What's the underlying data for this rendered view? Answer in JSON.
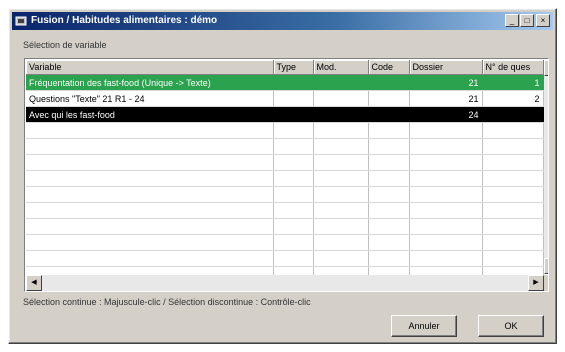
{
  "window": {
    "title": "Fusion / Habitudes alimentaires : démo",
    "minimize": "_",
    "maximize": "□",
    "close": "×"
  },
  "selection_label": "Sélection de variable",
  "table": {
    "columns": [
      "Variable",
      "Type",
      "Mod.",
      "Code",
      "Dossier",
      "N° de ques"
    ],
    "rows": [
      {
        "variable": "Fréquentation des fast-food (Unique -> Texte)",
        "type": "",
        "mod": "",
        "code": "",
        "dossier": "21",
        "num": "1",
        "state": "selected-green"
      },
      {
        "variable": "Questions \"Texte\" 21 R1 - 24",
        "type": "",
        "mod": "",
        "code": "",
        "dossier": "21",
        "num": "2",
        "state": "normal"
      },
      {
        "variable": "Avec qui les fast-food",
        "type": "",
        "mod": "",
        "code": "",
        "dossier": "24",
        "num": "",
        "state": "selected-black"
      },
      {
        "variable": "",
        "type": "",
        "mod": "",
        "code": "",
        "dossier": "",
        "num": "",
        "state": "normal"
      },
      {
        "variable": "",
        "type": "",
        "mod": "",
        "code": "",
        "dossier": "",
        "num": "",
        "state": "normal"
      },
      {
        "variable": "",
        "type": "",
        "mod": "",
        "code": "",
        "dossier": "",
        "num": "",
        "state": "normal"
      },
      {
        "variable": "",
        "type": "",
        "mod": "",
        "code": "",
        "dossier": "",
        "num": "",
        "state": "normal"
      },
      {
        "variable": "",
        "type": "",
        "mod": "",
        "code": "",
        "dossier": "",
        "num": "",
        "state": "normal"
      },
      {
        "variable": "",
        "type": "",
        "mod": "",
        "code": "",
        "dossier": "",
        "num": "",
        "state": "normal"
      },
      {
        "variable": "",
        "type": "",
        "mod": "",
        "code": "",
        "dossier": "",
        "num": "",
        "state": "normal"
      },
      {
        "variable": "",
        "type": "",
        "mod": "",
        "code": "",
        "dossier": "",
        "num": "",
        "state": "normal"
      },
      {
        "variable": "",
        "type": "",
        "mod": "",
        "code": "",
        "dossier": "",
        "num": "",
        "state": "normal"
      },
      {
        "variable": "",
        "type": "",
        "mod": "",
        "code": "",
        "dossier": "",
        "num": "",
        "state": "normal"
      }
    ]
  },
  "hint": "Sélection continue : Majuscule-clic / Sélection discontinue : Contrôle-clic",
  "buttons": {
    "cancel": "Annuler",
    "ok": "OK"
  },
  "colors": {
    "green_selection": "#2aa24e",
    "black_selection": "#000000",
    "title_bar": "#0a246a"
  },
  "icons": {
    "app": "app-icon",
    "scroll_up": "arrow-up-icon",
    "scroll_down": "arrow-down-icon",
    "scroll_left": "arrow-left-icon",
    "scroll_right": "arrow-right-icon"
  }
}
